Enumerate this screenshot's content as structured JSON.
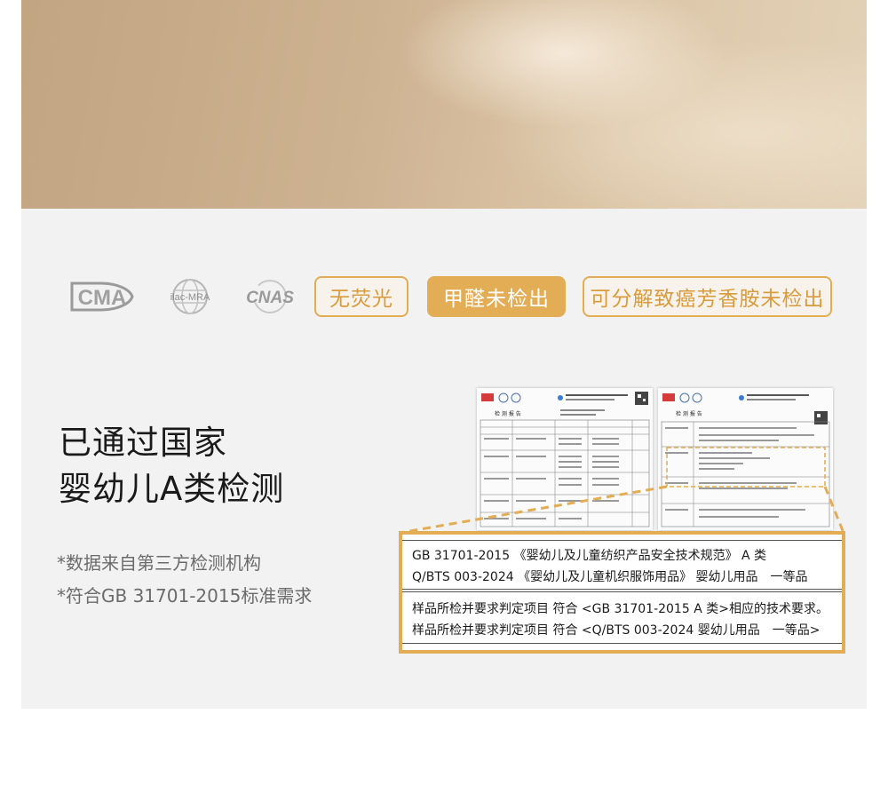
{
  "colors": {
    "accent": "#e2ad55",
    "panel_bg": "#f2f2f2",
    "headline": "#1a1a1a",
    "note": "#6b6b6b"
  },
  "logos": [
    {
      "icon": "cma-logo",
      "text": "CMA"
    },
    {
      "icon": "ilac-mra-logo",
      "text": "ilac-MRA"
    },
    {
      "icon": "cnas-logo",
      "text": "CNAS"
    }
  ],
  "badges": [
    {
      "label": "无荧光",
      "style": "outline"
    },
    {
      "label": "甲醛未检出",
      "style": "solid"
    },
    {
      "label": "可分解致癌芳香胺未检出",
      "style": "outline"
    }
  ],
  "headline": {
    "line1": "已通过国家",
    "line2": "婴幼儿A类检测"
  },
  "notes": {
    "line1": "*数据来自第三方检测机构",
    "line2": "*符合GB 31701-2015标准需求"
  },
  "report": {
    "title": "检 测 报 告",
    "docs": [
      {
        "icon": "test-report-page-1"
      },
      {
        "icon": "test-report-page-2"
      }
    ],
    "callout": {
      "line1": "GB 31701-2015 《婴幼儿及儿童纺织产品安全技术规范》 A 类",
      "line2": "Q/BTS 003-2024 《婴幼儿及儿童机织服饰用品》 婴幼儿用品　一等品",
      "line3": "样品所检并要求判定项目 符合 <GB 31701-2015 A 类>相应的技术要求。",
      "line4": "样品所检并要求判定项目 符合 <Q/BTS 003-2024 婴幼儿用品　一等品>"
    }
  }
}
